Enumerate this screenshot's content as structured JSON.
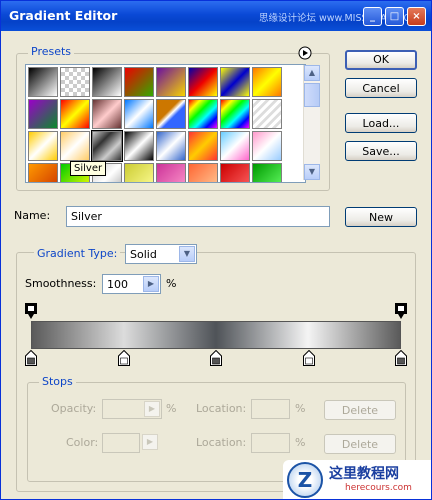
{
  "window": {
    "title": "Gradient Editor",
    "watermark": "思缘设计论坛 www.MISSYUAN.COM"
  },
  "presets": {
    "legend": "Presets",
    "tooltip": "Silver",
    "swatches": [
      "linear-gradient(135deg,#000,#fff)",
      "repeating-conic-gradient(#ccc 0 25%,#fff 0 50%) 0 0/8px 8px",
      "linear-gradient(135deg,#000,#fff)",
      "linear-gradient(135deg,#e00,#3a0)",
      "linear-gradient(135deg,#6a0fa0,#f7d400)",
      "linear-gradient(135deg,#00a,#e00,#ff0)",
      "linear-gradient(135deg,#ff0,#00c,#ff0)",
      "linear-gradient(135deg,#f70,#ff0,#f70)",
      "linear-gradient(135deg,#9a00c8,#0a8a2a)",
      "linear-gradient(135deg,#f00,#ff0,#f00)",
      "linear-gradient(135deg,#633,#fcc,#633)",
      "linear-gradient(135deg,#07f,#fff,#07f)",
      "linear-gradient(135deg,#c70 40%,#fff 50%,#36f 60%)",
      "linear-gradient(135deg,#f00,#ff0,#0f0,#0ff,#00f,#f0f)",
      "linear-gradient(135deg,#f00,#ff0,#0f0,#0ff,#00f,#f0f)",
      "repeating-linear-gradient(135deg,#fff 0 3px,#ddd 3px 6px)",
      "linear-gradient(135deg,#fc0,#fff,#fc0)",
      "linear-gradient(135deg,#fc6,#fff,#fc6)",
      "linear-gradient(135deg,#ccc,#333,#ccc,#333)",
      "linear-gradient(135deg,#000,#fff,#000)",
      "linear-gradient(135deg,#36c,#fff,#36c)",
      "linear-gradient(135deg,#f33,#fc0,#f33)",
      "linear-gradient(135deg,#6cf,#fff,#f6c)",
      "linear-gradient(135deg,#f9c,#fff,#9cf)",
      "linear-gradient(135deg,#f90,#c30)",
      "linear-gradient(135deg,#0c0,#ff0)",
      "linear-gradient(135deg,#ccc,#fff,#aaa)",
      "linear-gradient(135deg,#cc3,#ff9)",
      "linear-gradient(135deg,#c39,#f9c)",
      "linear-gradient(135deg,#f63,#fc9)",
      "linear-gradient(135deg,#c00,#f66)",
      "linear-gradient(135deg,#090,#6f6)"
    ]
  },
  "buttons": {
    "ok": "OK",
    "cancel": "Cancel",
    "load": "Load...",
    "save": "Save...",
    "new": "New"
  },
  "name": {
    "label": "Name:",
    "value": "Silver"
  },
  "gradient": {
    "type_label": "Gradient Type:",
    "type_value": "Solid",
    "smoothness_label": "Smoothness:",
    "smoothness_value": "100",
    "smoothness_unit": "%",
    "color_stops": [
      0,
      25,
      50,
      75,
      100
    ],
    "opacity_stops": [
      0,
      100
    ]
  },
  "stops": {
    "legend": "Stops",
    "opacity_label": "Opacity:",
    "opacity_unit": "%",
    "location_label": "Location:",
    "location_unit": "%",
    "delete_label": "Delete",
    "color_label": "Color:",
    "location_label_2": "Location:",
    "location_unit_2": "%",
    "delete_label_2": "Delete"
  }
}
